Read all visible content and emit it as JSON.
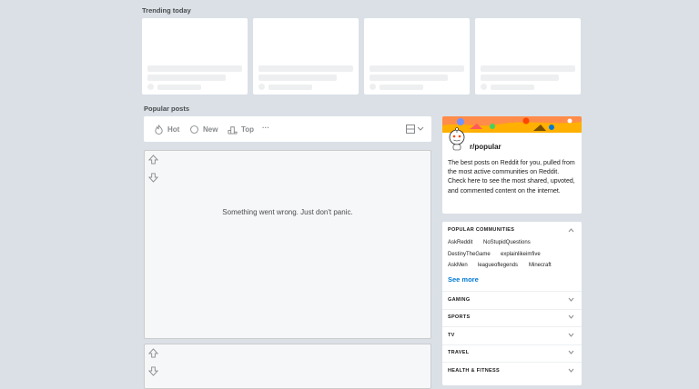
{
  "trending": {
    "title": "Trending today"
  },
  "popular": {
    "title": "Popular posts"
  },
  "sort": {
    "hot": "Hot",
    "new": "New",
    "top": "Top",
    "more": "···"
  },
  "post": {
    "error": "Something went wrong. Just don't panic."
  },
  "sidebar": {
    "sub_name": "r/popular",
    "description": "The best posts on Reddit for you, pulled from the most active communities on Reddit. Check here to see the most shared, upvoted, and commented content on the internet.",
    "popular_header": "POPULAR COMMUNITIES",
    "communities": [
      "AskReddit",
      "NoStupidQuestions",
      "DestinyTheGame",
      "explainlikeimfive",
      "AskMen",
      "leagueoflegends",
      "Minecraft"
    ],
    "see_more": "See more",
    "categories": [
      "GAMING",
      "SPORTS",
      "TV",
      "TRAVEL",
      "HEALTH & FITNESS"
    ]
  },
  "colors": {
    "accent": "#0079d3",
    "background": "#dae0e6",
    "skeleton": "#edeff1"
  }
}
